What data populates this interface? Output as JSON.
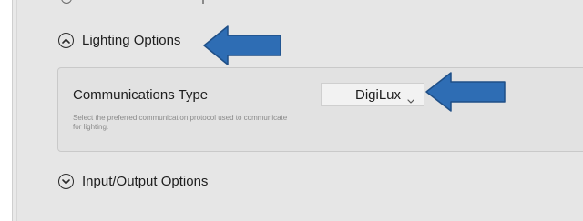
{
  "sections": {
    "lighting": {
      "label": "Lighting Options",
      "state": "expanded",
      "icon": "chevron-up-icon"
    },
    "io": {
      "label": "Input/Output Options",
      "state": "collapsed",
      "icon": "chevron-down-icon"
    }
  },
  "communications": {
    "label": "Communications Type",
    "help_text": "Select the preferred communication protocol used to communicate for lighting.",
    "selected_value": "DigiLux"
  },
  "annotations": {
    "arrow_color": "#2e6db4",
    "arrow_icon": "arrow-left-icon"
  }
}
